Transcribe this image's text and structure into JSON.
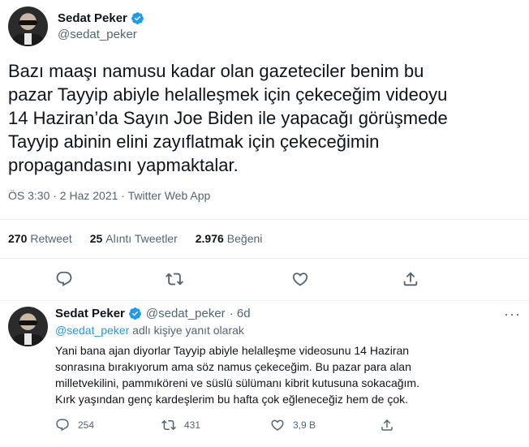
{
  "tweet": {
    "author": {
      "display_name": "Sedat Peker",
      "handle": "@sedat_peker"
    },
    "lines": [
      "Bazı maaşı namusu kadar olan gazeteciler benim bu",
      "pazar Tayyip abiyle helalleşmek için çekeceğim videoyu",
      "14 Haziran’da Sayın Joe Biden ile yapacağı görüşmede",
      "Tayyip abinin elini zayıflatmak için çekeceğimin",
      "propagandasını yapmaktalar."
    ],
    "meta": "ÖS 3:30 · 2 Haz 2021 · Twitter Web App",
    "stats": {
      "retweets_count": "270",
      "retweets_label": "Retweet",
      "quotes_count": "25",
      "quotes_label": "Alıntı Tweetler",
      "likes_count": "2.976",
      "likes_label": "Beğeni"
    },
    "actions": [
      "reply-icon",
      "retweet-icon",
      "like-icon",
      "share-icon"
    ]
  },
  "reply": {
    "author": {
      "display_name": "Sedat Peker",
      "handle": "@sedat_peker",
      "age": "· 6d"
    },
    "reply_to_handle": "@sedat_peker",
    "reply_to_suffix": " adlı kişiye yanıt olarak",
    "lines": [
      "Yani bana ajan diyorlar Tayyip abiyle helalleşme videosunu 14 Haziran",
      "sonrasına bırakıyorum ama söz namus çekeceğim. Bu pazar para alan",
      "milletvekilini, pammıköreni ve süslü sülümanı kibrit kutusuna sokacağım.",
      "Kırk yaşından genç kardeşlerim bu hafta çok eğleneceğiz hem de çok."
    ],
    "counts": {
      "replies": "254",
      "retweets": "431",
      "likes": "3,9 B"
    },
    "more": "···"
  },
  "colors": {
    "verified": "#1d9bf0",
    "link": "#1d9bf0",
    "muted": "#536471",
    "divider": "#eff3f4"
  }
}
